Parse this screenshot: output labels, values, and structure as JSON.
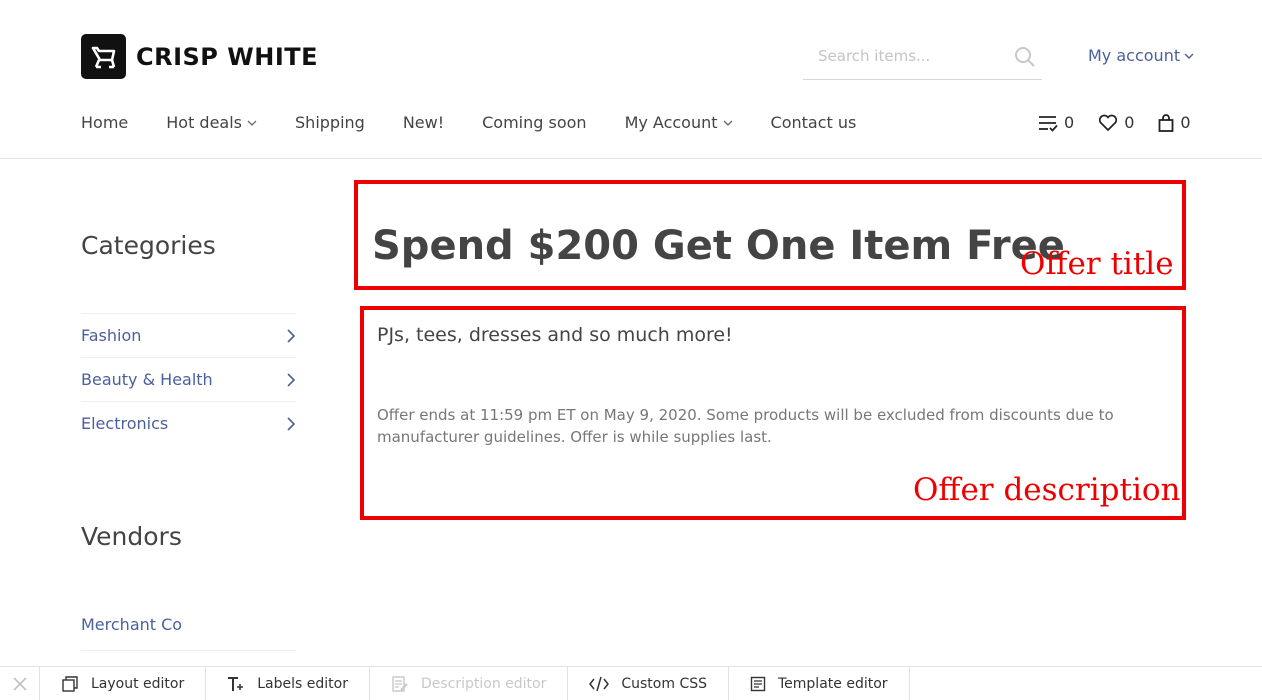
{
  "brand": {
    "name": "CRISP WHITE",
    "logo_icon": "cart-icon"
  },
  "search": {
    "placeholder": "Search items..."
  },
  "header": {
    "account_label": "My account"
  },
  "nav": [
    {
      "label": "Home",
      "dropdown": false
    },
    {
      "label": "Hot deals",
      "dropdown": true
    },
    {
      "label": "Shipping",
      "dropdown": false
    },
    {
      "label": "New!",
      "dropdown": false
    },
    {
      "label": "Coming soon",
      "dropdown": false
    },
    {
      "label": "My Account",
      "dropdown": true
    },
    {
      "label": "Contact us",
      "dropdown": false
    }
  ],
  "counters": {
    "compare": "0",
    "wishlist": "0",
    "cart": "0"
  },
  "sidebar": {
    "categories_title": "Categories",
    "categories": [
      {
        "label": "Fashion"
      },
      {
        "label": "Beauty & Health"
      },
      {
        "label": "Electronics"
      }
    ],
    "vendors_title": "Vendors",
    "vendors": [
      {
        "label": "Merchant Co"
      }
    ]
  },
  "offer": {
    "title": "Spend $200 Get One Item Free",
    "subtitle": "PJs, tees, dresses and so much more!",
    "fine_print": "Offer ends at 11:59 pm ET on May 9, 2020. Some products will be excluded from discounts due to manufacturer guidelines. Offer is while supplies last."
  },
  "annotations": {
    "title_label": "Offer title",
    "description_label": "Offer description",
    "color": "#ee0000"
  },
  "toolbar": {
    "items": [
      {
        "label": "Layout editor",
        "icon": "layout-icon",
        "disabled": false
      },
      {
        "label": "Labels editor",
        "icon": "text-plus-icon",
        "disabled": false
      },
      {
        "label": "Description editor",
        "icon": "document-edit-icon",
        "disabled": true
      },
      {
        "label": "Custom CSS",
        "icon": "code-icon",
        "disabled": false
      },
      {
        "label": "Template editor",
        "icon": "template-icon",
        "disabled": false
      }
    ]
  }
}
